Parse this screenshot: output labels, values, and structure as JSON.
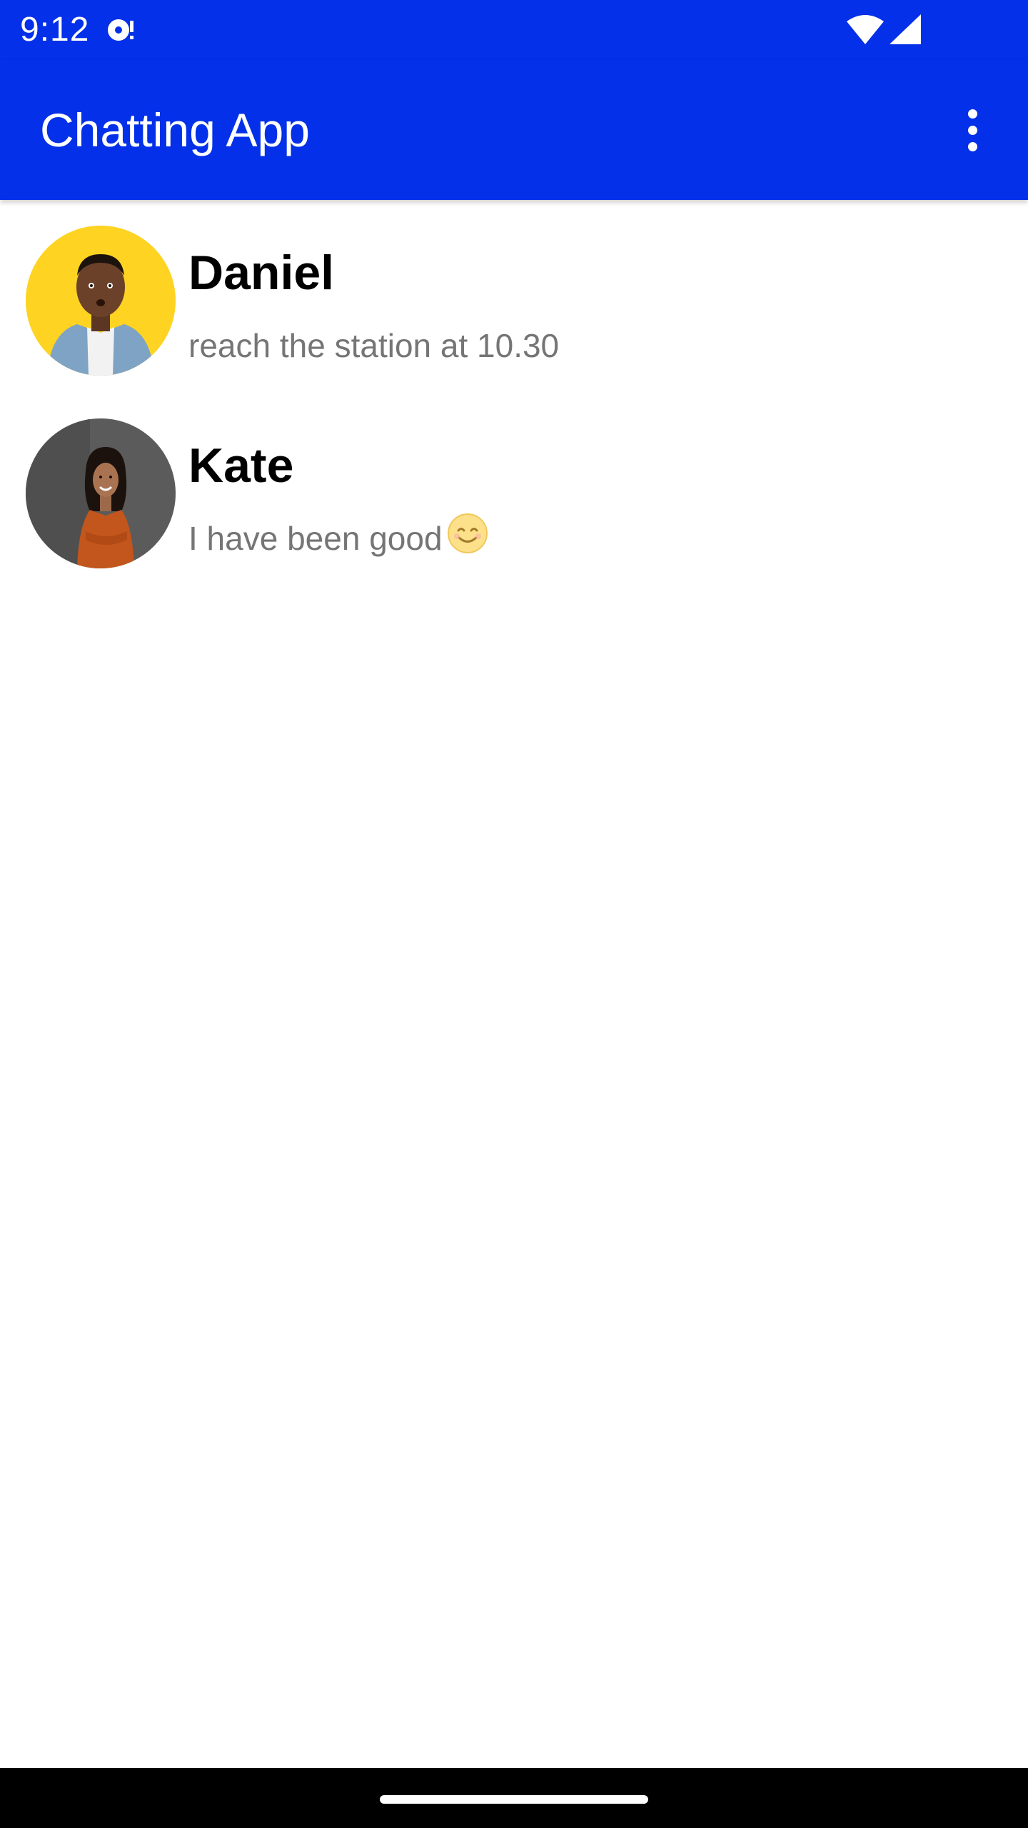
{
  "status_bar": {
    "time": "9:12",
    "icons": [
      "sync-icon",
      "wifi-icon",
      "cell-signal-icon"
    ]
  },
  "app_bar": {
    "title": "Chatting App",
    "menu_icon": "more-vert-icon",
    "color": "#0330e8"
  },
  "chats": [
    {
      "name": "Daniel",
      "preview": "reach the station at 10.30",
      "avatar_bg": "#fed321"
    },
    {
      "name": "Kate",
      "preview": "I have been good",
      "emoji_icon": "smiling-face-icon",
      "avatar_bg": "#5b5b5b"
    }
  ],
  "colors": {
    "accent": "#0330e8",
    "name_text": "#000000",
    "preview_text": "#757575",
    "nav_bar": "#000000"
  }
}
